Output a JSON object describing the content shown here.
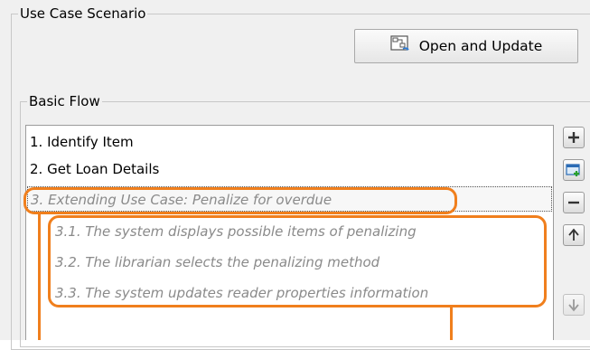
{
  "use_case_scenario": {
    "title": "Use Case Scenario",
    "open_update_label": "Open and Update",
    "open_update_icon": "diagram-update-icon"
  },
  "basic_flow": {
    "title": "Basic Flow",
    "steps": [
      "1. Identify Item",
      "2. Get Loan Details",
      "3. Extending Use Case: Penalize for overdue",
      "3.1. The system displays possible items of penalizing",
      "3.2. The librarian selects the penalizing method",
      "3.3. The system updates reader properties information"
    ],
    "side_buttons": [
      "add-icon",
      "insert-row-icon",
      "remove-icon",
      "move-up-icon",
      "move-down-icon"
    ]
  },
  "colors": {
    "annotation": "#f07f1d",
    "extension_text": "#8a8a8a"
  }
}
